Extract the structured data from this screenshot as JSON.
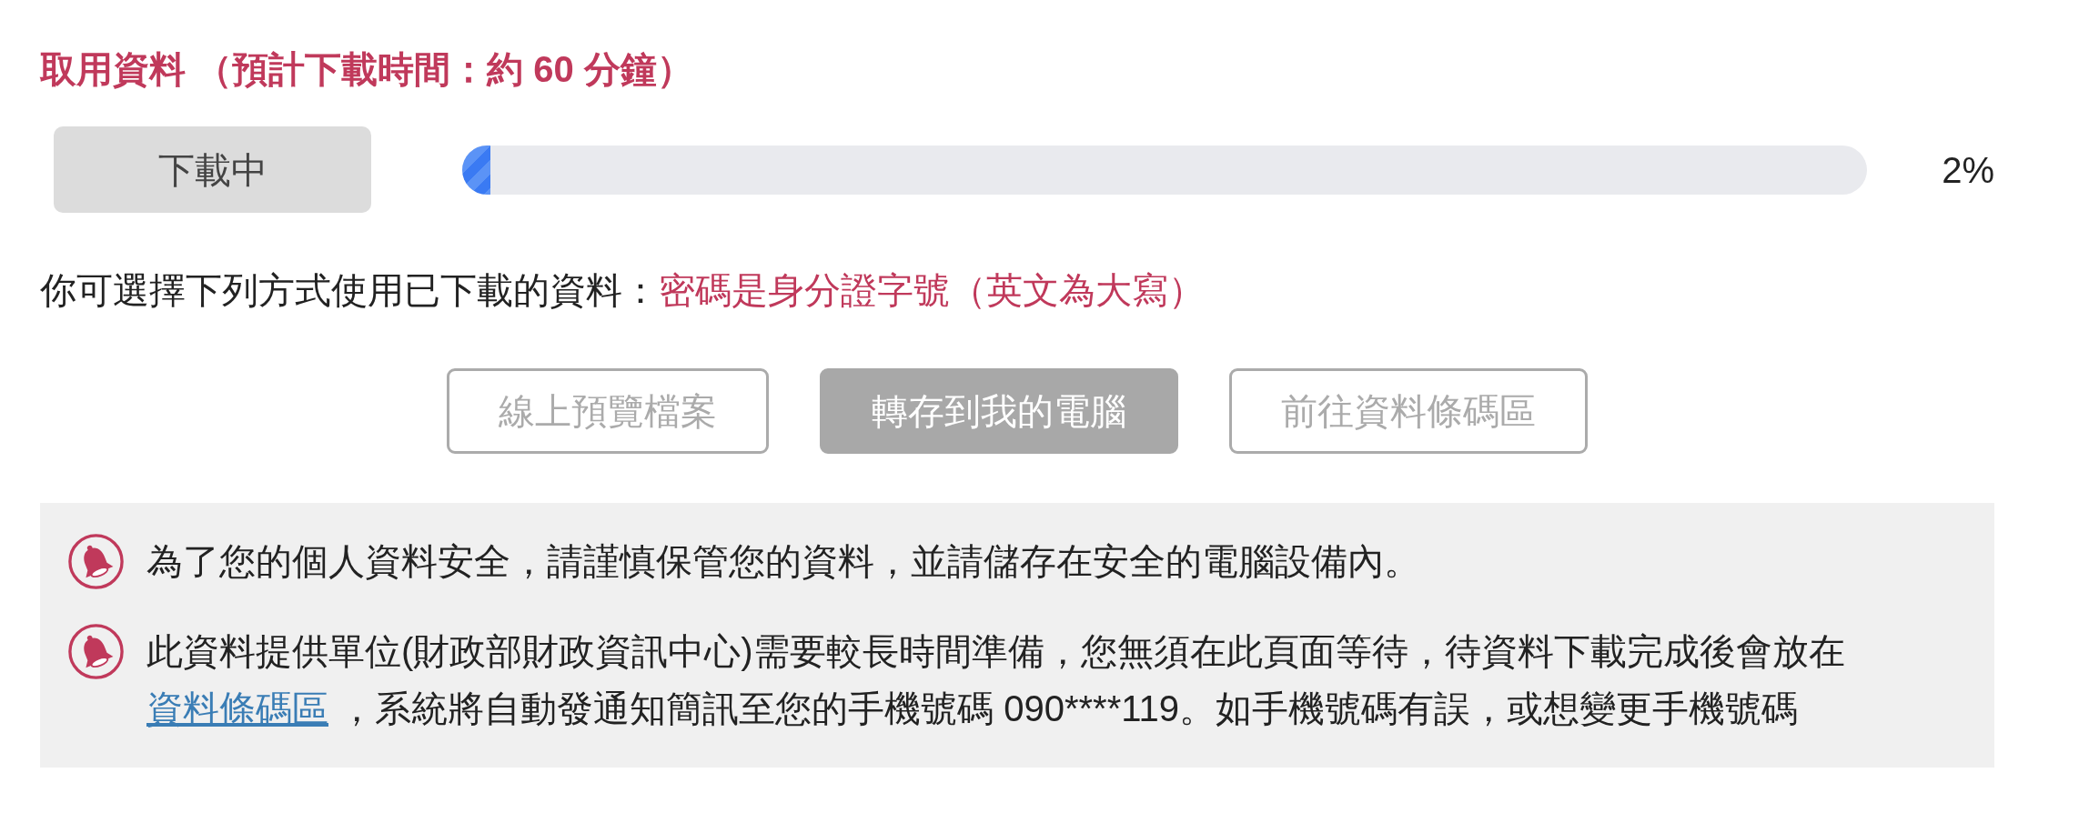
{
  "section": {
    "title": "取用資料 （預計下載時間：約 60 分鐘）"
  },
  "download": {
    "status_button": {
      "label": "下載中"
    },
    "progress": {
      "level": 0.02
    },
    "percent": "2%"
  },
  "instructions": {
    "text": "你可選擇下列方式使用已下載的資料：",
    "note": "密碼是身分證字號（英文為大寫）"
  },
  "actions": [
    {
      "label": "線上預覽檔案",
      "kind": "outline",
      "disabled": true
    },
    {
      "label": "轉存到我的電腦",
      "kind": "filled",
      "disabled": true
    },
    {
      "label": "前往資料條碼區",
      "kind": "outline",
      "disabled": true
    }
  ],
  "notices": [
    {
      "text": "為了您的個人資料安全，請謹慎保管您的資料，並請儲存在安全的電腦設備內。"
    },
    {
      "text": "此資料提供單位(財政部財政資訊中心)需要較長時間準備，您無須在此頁面等待，待資料下載完成後會放在 ",
      "link": "資料條碼區",
      "text_after": " ，系統將自動發通知簡訊至您的手機號碼 090****119。如手機號碼有誤，或想變更手機號碼"
    }
  ]
}
